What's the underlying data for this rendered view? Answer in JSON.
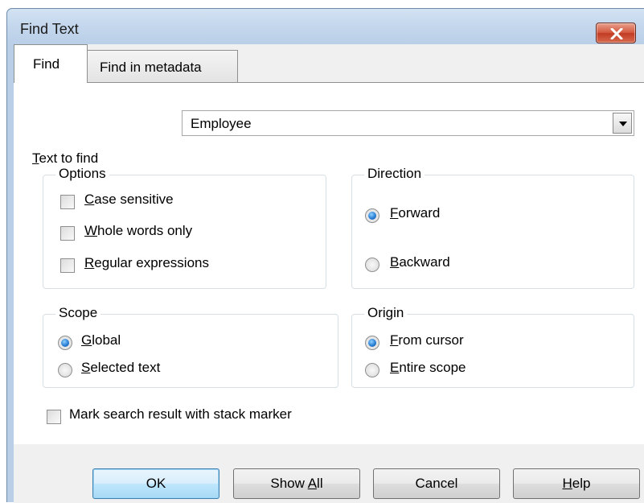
{
  "window": {
    "title": "Find Text"
  },
  "tabs": [
    {
      "label": "Find",
      "selected": true
    },
    {
      "label": "Find in metadata",
      "selected": false
    }
  ],
  "text_to_find": {
    "label_key": "T",
    "label_rest": "ext to find",
    "value": "Employee"
  },
  "options": {
    "title": "Options",
    "items": [
      {
        "key": "C",
        "rest": "ase sensitive",
        "checked": false
      },
      {
        "key": "W",
        "rest": "hole words only",
        "checked": false
      },
      {
        "key": "R",
        "rest": "egular expressions",
        "checked": false
      }
    ]
  },
  "direction": {
    "title": "Direction",
    "items": [
      {
        "key": "F",
        "rest": "orward",
        "selected": true
      },
      {
        "key": "B",
        "rest": "ackward",
        "selected": false
      }
    ]
  },
  "scope": {
    "title": "Scope",
    "items": [
      {
        "key": "G",
        "rest": "lobal",
        "selected": true
      },
      {
        "key": "S",
        "rest": "elected text",
        "selected": false
      }
    ]
  },
  "origin": {
    "title": "Origin",
    "items": [
      {
        "key": "F",
        "rest": "rom cursor",
        "selected": true
      },
      {
        "key": "E",
        "rest": "ntire scope",
        "selected": false
      }
    ]
  },
  "mark_result": {
    "label": "Mark search result with stack marker",
    "checked": false
  },
  "buttons": {
    "ok": "OK",
    "show_all_pre": "Show ",
    "show_all_key": "A",
    "show_all_post": "ll",
    "cancel": "Cancel",
    "help_key": "H",
    "help_rest": "elp"
  }
}
